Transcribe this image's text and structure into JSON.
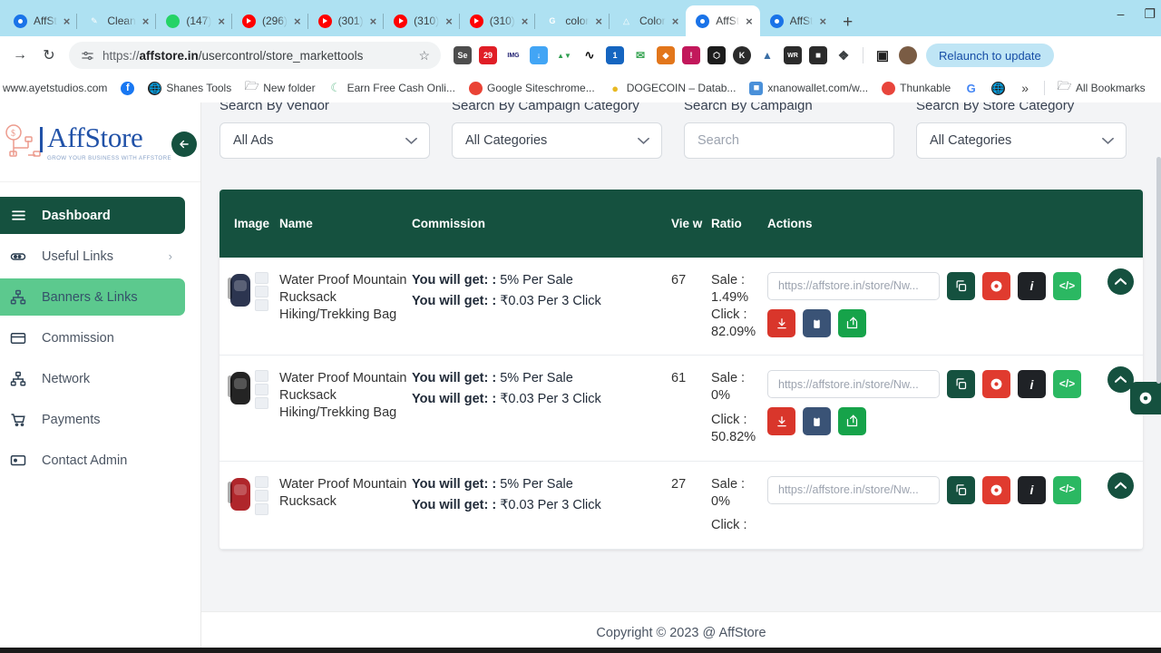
{
  "browser": {
    "tabs": [
      {
        "label": "AffSt",
        "icon": "affstore-favicon"
      },
      {
        "label": "Clean",
        "icon": "eraser-favicon"
      },
      {
        "label": "(147)",
        "icon": "whatsapp-favicon"
      },
      {
        "label": "(296)",
        "icon": "youtube-favicon"
      },
      {
        "label": "(301)",
        "icon": "youtube-favicon"
      },
      {
        "label": "(310)",
        "icon": "youtube-favicon"
      },
      {
        "label": "(310)",
        "icon": "youtube-favicon"
      },
      {
        "label": "color",
        "icon": "google-favicon"
      },
      {
        "label": "Color",
        "icon": "triangle-favicon"
      },
      {
        "label": "AffSt",
        "icon": "affstore-favicon"
      },
      {
        "label": "AffSt",
        "icon": "affstore-favicon"
      }
    ],
    "active_tab_index": 9,
    "new_tab_label": "+",
    "close_label": "×",
    "window_controls": {
      "minimize": "–",
      "maximize": "❐"
    },
    "nav": {
      "forward": "→",
      "reload": "↻"
    },
    "omnibox": {
      "url_prefix": "https://",
      "url_domain": "affstore.in",
      "url_path": "/usercontrol/store_markettools",
      "full_url": "https://affstore.in/usercontrol/store_markettools",
      "star": "☆",
      "site_settings_icon": "tune-icon"
    },
    "extensions": [
      {
        "name": "selenium-ext",
        "glyph": "Se",
        "color": "#4d4d4d"
      },
      {
        "name": "downloader-ext",
        "glyph": "29",
        "color": "#e01e26"
      },
      {
        "name": "img-ext",
        "glyph": "IMG",
        "color": "#ffffff",
        "text_color": "#1a1a6e"
      },
      {
        "name": "download-blue-ext",
        "glyph": "↓",
        "color": "#42a5f5"
      },
      {
        "name": "triangles-ext",
        "glyph": "▲▼",
        "color": "#ffffff",
        "text_color": "#2e9e4f"
      },
      {
        "name": "hook-ext",
        "glyph": "ʕ",
        "color": "#ffffff",
        "text_color": "#111"
      },
      {
        "name": "badge1-ext",
        "glyph": "1",
        "color": "#1565c0"
      },
      {
        "name": "mail-ext",
        "glyph": "✉",
        "color": "#ffffff",
        "text_color": "#3aa655"
      },
      {
        "name": "metamask-ext",
        "glyph": "◆",
        "color": "#e2761b"
      },
      {
        "name": "alert-ext",
        "glyph": "!",
        "color": "#c2185b"
      },
      {
        "name": "honey-ext",
        "glyph": "⬡",
        "color": "#1c1c1c"
      },
      {
        "name": "kite-ext",
        "glyph": "K",
        "color": "#2b2b2b"
      },
      {
        "name": "chart-ext",
        "glyph": "‖",
        "color": "#ffffff",
        "text_color": "#3a6ea5"
      },
      {
        "name": "wr-ext",
        "glyph": "WR",
        "color": "#2b2b2b"
      },
      {
        "name": "robot-ext",
        "glyph": "■",
        "color": "#2b2b2b"
      },
      {
        "name": "puzzle-ext",
        "glyph": "❖",
        "color": "#ffffff",
        "text_color": "#3c4043"
      }
    ],
    "side_panel_icon": "side-panel-icon",
    "profile_icon": "profile-avatar",
    "relaunch_label": "Relaunch to update",
    "bookmarks": [
      {
        "label": "www.ayetstudios.com",
        "icon": "globe",
        "color": "transparent"
      },
      {
        "label": "",
        "icon": "facebook",
        "color": "#1877f2"
      },
      {
        "label": "Shanes Tools",
        "icon": "globe-dark",
        "color": "#222"
      },
      {
        "label": "New folder",
        "icon": "folder",
        "color": "transparent"
      },
      {
        "label": "Earn Free Cash Onli...",
        "icon": "crescent",
        "color": "#77c49a"
      },
      {
        "label": "Google Siteschrome...",
        "icon": "chrome",
        "color": "#ea4335"
      },
      {
        "label": "DOGECOIN – Datab...",
        "icon": "doge",
        "color": "#e8b923"
      },
      {
        "label": "xnanowallet.com/w...",
        "icon": "wallet",
        "color": "#4a90d9"
      },
      {
        "label": "Thunkable",
        "icon": "thunkable",
        "color": "#e8453c"
      },
      {
        "label": "",
        "icon": "google-g",
        "color": "#4285f4"
      },
      {
        "label": "",
        "icon": "globe-dark2",
        "color": "#222"
      }
    ],
    "bookmarks_overflow": "»",
    "all_bookmarks_label": "All Bookmarks"
  },
  "sidebar": {
    "logo_name_1": "A",
    "logo_name_2": "ff",
    "logo_name_3": "S",
    "logo_name_4": "tore",
    "logo_full": "AffStore",
    "tagline": "Grow Your Business With AffStore",
    "back_icon": "arrow-left-icon",
    "items": [
      {
        "label": "Dashboard",
        "icon": "hamburger-icon",
        "state": "active-dark"
      },
      {
        "label": "Useful Links",
        "icon": "link-icon",
        "state": "normal",
        "chevron": "›"
      },
      {
        "label": "Banners & Links",
        "icon": "sitemap-icon",
        "state": "active-green"
      },
      {
        "label": "Commission",
        "icon": "wallet-icon",
        "state": "normal"
      },
      {
        "label": "Network",
        "icon": "sitemap-icon",
        "state": "normal"
      },
      {
        "label": "Payments",
        "icon": "cart-icon",
        "state": "normal"
      },
      {
        "label": "Contact Admin",
        "icon": "message-icon",
        "state": "normal"
      }
    ]
  },
  "filters": [
    {
      "label": "Search By Vendor",
      "value": "All Ads",
      "type": "select",
      "caret": "⌄"
    },
    {
      "label": "Search By Campaign Category",
      "value": "All Categories",
      "type": "select",
      "caret": "⌄"
    },
    {
      "label": "Search By Campaign",
      "value": "Search",
      "type": "input",
      "placeholder": "Search"
    },
    {
      "label": "Search By Store Category",
      "value": "All Categories",
      "type": "select",
      "caret": "⌄"
    }
  ],
  "table": {
    "headers": {
      "image": "Image",
      "name": "Name",
      "commission": "Commission",
      "view": "Vie w",
      "ratio": "Ratio",
      "actions": "Actions"
    },
    "rows": [
      {
        "name": "Water Proof Mountain Rucksack Hiking/Trekking Bag",
        "commission_label_1": "You will get: :",
        "commission_value_1": " 5% Per Sale",
        "commission_label_2": "You will get: :",
        "commission_value_2": " ₹0.03 Per 3 Click",
        "view": "67",
        "ratio_sale": "Sale : 1.49%",
        "ratio_sale_label": "Sale :",
        "ratio_sale_value": "1.49%",
        "ratio_click_label": "Click :",
        "ratio_click_value": "82.09%",
        "link_value": "https://affstore.in/store/Nw...",
        "thumb_color": "#2c3550"
      },
      {
        "name": "Water Proof Mountain Rucksack Hiking/Trekking Bag",
        "commission_label_1": "You will get: :",
        "commission_value_1": " 5% Per Sale",
        "commission_label_2": "You will get: :",
        "commission_value_2": " ₹0.03 Per 3 Click",
        "view": "61",
        "ratio_sale_label": "Sale : 0%",
        "ratio_sale_value": "",
        "ratio_click_label": "Click :",
        "ratio_click_value": "50.82%",
        "link_value": "https://affstore.in/store/Nw...",
        "thumb_color": "#242424"
      },
      {
        "name": "Water Proof Mountain Rucksack",
        "commission_label_1": "You will get: :",
        "commission_value_1": " 5% Per Sale",
        "commission_label_2": "You will get: :",
        "commission_value_2": " ₹0.03 Per 3 Click",
        "view": "27",
        "ratio_sale_label": "Sale : 0%",
        "ratio_sale_value": "",
        "ratio_click_label": "Click :",
        "ratio_click_value": "",
        "link_value": "https://affstore.in/store/Nw...",
        "thumb_color": "#b0262b"
      }
    ],
    "action_buttons": [
      {
        "name": "copy-link-button",
        "glyph": "⧉",
        "color": "#15513f"
      },
      {
        "name": "settings-button",
        "glyph": "✻",
        "color": "#e03b2f"
      },
      {
        "name": "info-button",
        "glyph": "i",
        "color": "#1f2226"
      },
      {
        "name": "embed-code-button",
        "glyph": "</>",
        "color": "#2bb862"
      },
      {
        "name": "download-button",
        "glyph": "⬇",
        "color": "#d9362b"
      },
      {
        "name": "clipboard-button",
        "glyph": "❐",
        "color": "#3a5376"
      },
      {
        "name": "share-button",
        "glyph": "↱",
        "color": "#16a34a"
      }
    ],
    "collapse_icon": "⌃"
  },
  "floating_action": {
    "icon": "gear-icon",
    "glyph": "✻"
  },
  "footer": {
    "copyright": "Copyright © 2023 @ AffStore"
  }
}
